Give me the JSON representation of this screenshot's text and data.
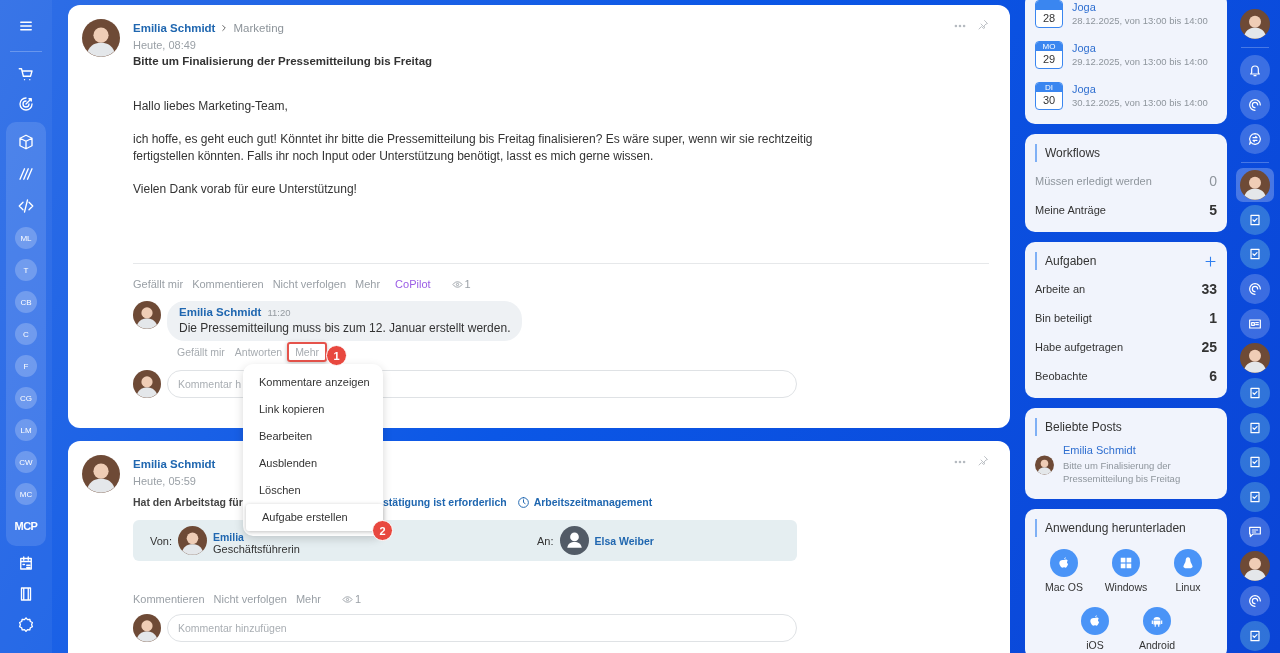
{
  "nav": {
    "top": [
      {
        "kind": "menu"
      },
      {
        "kind": "cart"
      },
      {
        "kind": "target"
      }
    ],
    "group": [
      {
        "kind": "cube"
      },
      {
        "kind": "stripes"
      },
      {
        "kind": "code"
      },
      {
        "kind": "initials",
        "label": "ML"
      },
      {
        "kind": "initials",
        "label": "T"
      },
      {
        "kind": "initials",
        "label": "CB"
      },
      {
        "kind": "initials",
        "label": "C"
      },
      {
        "kind": "initials",
        "label": "F"
      },
      {
        "kind": "initials",
        "label": "CG"
      },
      {
        "kind": "initials",
        "label": "LM"
      },
      {
        "kind": "initials",
        "label": "CW"
      },
      {
        "kind": "initials",
        "label": "MC"
      },
      {
        "kind": "text",
        "label": "MCP"
      }
    ],
    "bottom": [
      {
        "kind": "calendar"
      },
      {
        "kind": "device"
      }
    ],
    "footer": [
      {
        "kind": "settings"
      }
    ]
  },
  "posts": [
    {
      "author": "Emilia Schmidt",
      "recipient": "Marketing",
      "time": "Heute, 08:49",
      "title": "Bitte um Finalisierung der Pressemitteilung bis Freitag",
      "paragraphs": [
        "Hallo liebes Marketing-Team,",
        "ich hoffe, es geht euch gut! Könntet ihr bitte die Pressemitteilung bis Freitag finalisieren? Es wäre super, wenn wir sie rechtzeitig fertigstellen könnten. Falls ihr noch Input oder Unterstützung benötigt, lasst es mich gerne wissen.",
        "Vielen Dank vorab für eure Unterstützung!"
      ],
      "actions": [
        {
          "kind": "link",
          "label": "Gefällt mir"
        },
        {
          "kind": "link",
          "label": "Kommentieren"
        },
        {
          "kind": "link",
          "label": "Nicht verfolgen"
        },
        {
          "kind": "link",
          "label": "Mehr"
        },
        {
          "kind": "copilot",
          "label": "CoPilot"
        },
        {
          "kind": "views",
          "label": "1"
        }
      ],
      "comments": [
        {
          "author": "Emilia Schmidt",
          "time": "11:20",
          "text": "Die Pressemitteilung muss bis zum 12. Januar erstellt werden.",
          "actions": [
            {
              "label": "Gefällt mir"
            },
            {
              "label": "Antworten"
            },
            {
              "label": "Mehr",
              "callout": "1"
            }
          ]
        }
      ],
      "comment_field": {
        "placeholder": "Kommentar h"
      }
    },
    {
      "author": "Emilia Schmidt",
      "time": "Heute, 05:59",
      "summary": [
        "Hat den Arbeitstag für",
        "stätigung ist erforderlich"
      ],
      "source": "Arbeitszeitmanagement",
      "transfer": {
        "from_label": "Von:",
        "from_name": "Emilia",
        "from_role": "Geschäftsführerin",
        "to_label": "An:",
        "to_name": "Elsa Weiber"
      },
      "actions": [
        {
          "kind": "link",
          "label": "Kommentieren"
        },
        {
          "kind": "link",
          "label": "Nicht verfolgen"
        },
        {
          "kind": "link",
          "label": "Mehr"
        },
        {
          "kind": "views",
          "label": "1"
        }
      ],
      "comment_field": {
        "placeholder": "Kommentar hinzufügen"
      }
    }
  ],
  "context_menu": {
    "items": [
      {
        "label": "Kommentare anzeigen"
      },
      {
        "label": "Link kopieren"
      },
      {
        "label": "Bearbeiten"
      },
      {
        "label": "Ausblenden"
      },
      {
        "label": "Löschen"
      },
      {
        "label": "Aufgabe erstellen",
        "callout": "2"
      }
    ]
  },
  "calendar": {
    "events": [
      {
        "day": "28",
        "title": "Joga",
        "time": "28.12.2025, von 13:00 bis 14:00"
      },
      {
        "weekday": "MO",
        "day": "29",
        "title": "Joga",
        "time": "29.12.2025, von 13:00 bis 14:00"
      },
      {
        "weekday": "DI",
        "day": "30",
        "title": "Joga",
        "time": "30.12.2025, von 13:00 bis 14:00"
      }
    ]
  },
  "workflows": {
    "title": "Workflows",
    "rows": [
      {
        "label": "Müssen erledigt werden",
        "count": "0",
        "muted": true
      },
      {
        "label": "Meine Anträge",
        "count": "5",
        "muted": false
      }
    ]
  },
  "tasks": {
    "title": "Aufgaben",
    "rows": [
      {
        "label": "Arbeite an",
        "count": "33",
        "muted": false
      },
      {
        "label": "Bin beteiligt",
        "count": "1",
        "muted": false
      },
      {
        "label": "Habe aufgetragen",
        "count": "25",
        "muted": false
      },
      {
        "label": "Beobachte",
        "count": "6",
        "muted": false
      }
    ]
  },
  "popular_posts": {
    "title": "Beliebte Posts",
    "items": [
      {
        "author": "Emilia Schmidt",
        "text": "Bitte um Finalisierung der Pressemitteilung bis Freitag"
      }
    ]
  },
  "downloads": {
    "title": "Anwendung herunterladen",
    "apps": [
      {
        "kind": "apple",
        "label": "Mac OS"
      },
      {
        "kind": "windows",
        "label": "Windows"
      },
      {
        "kind": "linux",
        "label": "Linux"
      },
      {
        "kind": "apple",
        "label": "iOS"
      },
      {
        "kind": "android",
        "label": "Android"
      }
    ]
  },
  "rail": [
    {
      "items": [
        {
          "kind": "avatar",
          "selected": false
        }
      ]
    },
    {
      "items": [
        {
          "kind": "bell",
          "selected": false
        },
        {
          "kind": "spiral",
          "selected": false
        },
        {
          "kind": "chat-swap",
          "selected": false
        }
      ]
    },
    {
      "items": [
        {
          "kind": "avatar",
          "selected": true
        },
        {
          "kind": "task",
          "selected": false
        },
        {
          "kind": "task",
          "selected": false
        },
        {
          "kind": "spiral",
          "selected": false
        },
        {
          "kind": "card",
          "selected": false
        },
        {
          "kind": "avatar",
          "selected": false
        },
        {
          "kind": "task",
          "selected": false
        },
        {
          "kind": "task",
          "selected": false
        },
        {
          "kind": "task",
          "selected": false
        },
        {
          "kind": "task",
          "selected": false
        },
        {
          "kind": "chat",
          "selected": false
        },
        {
          "kind": "avatar",
          "selected": false
        },
        {
          "kind": "spiral",
          "selected": false
        },
        {
          "kind": "task",
          "selected": false
        }
      ]
    }
  ]
}
